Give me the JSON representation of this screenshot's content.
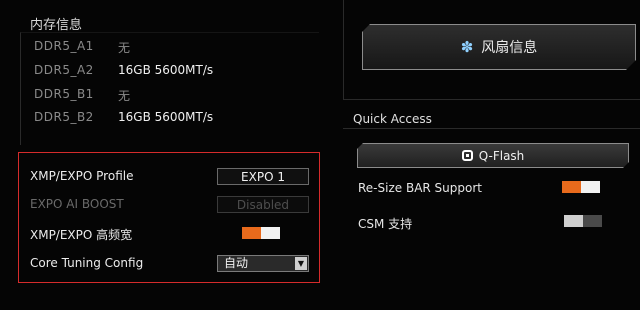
{
  "memory": {
    "title": "内存信息",
    "slots": [
      {
        "name": "DDR5_A1",
        "value": "无"
      },
      {
        "name": "DDR5_A2",
        "value": "16GB 5600MT/s"
      },
      {
        "name": "DDR5_B1",
        "value": "无"
      },
      {
        "name": "DDR5_B2",
        "value": "16GB 5600MT/s"
      }
    ]
  },
  "fan": {
    "label": "风扇信息",
    "icon": "fan-icon"
  },
  "quick_access": {
    "title": "Quick Access",
    "qflash_label": "Q-Flash",
    "rebar_label": "Re-Size BAR Support",
    "rebar_enabled": true,
    "csm_label": "CSM 支持",
    "csm_enabled": false
  },
  "xmp": {
    "profile_label": "XMP/EXPO Profile",
    "profile_value": "EXPO 1",
    "ai_boost_label": "EXPO AI BOOST",
    "ai_boost_value": "Disabled",
    "high_freq_label": "XMP/EXPO 高频宽",
    "high_freq_enabled": true,
    "core_tuning_label": "Core Tuning Config",
    "core_tuning_value": "自动"
  },
  "colors": {
    "accent_orange": "#e86a1c",
    "highlight_red": "#d52b2b"
  }
}
